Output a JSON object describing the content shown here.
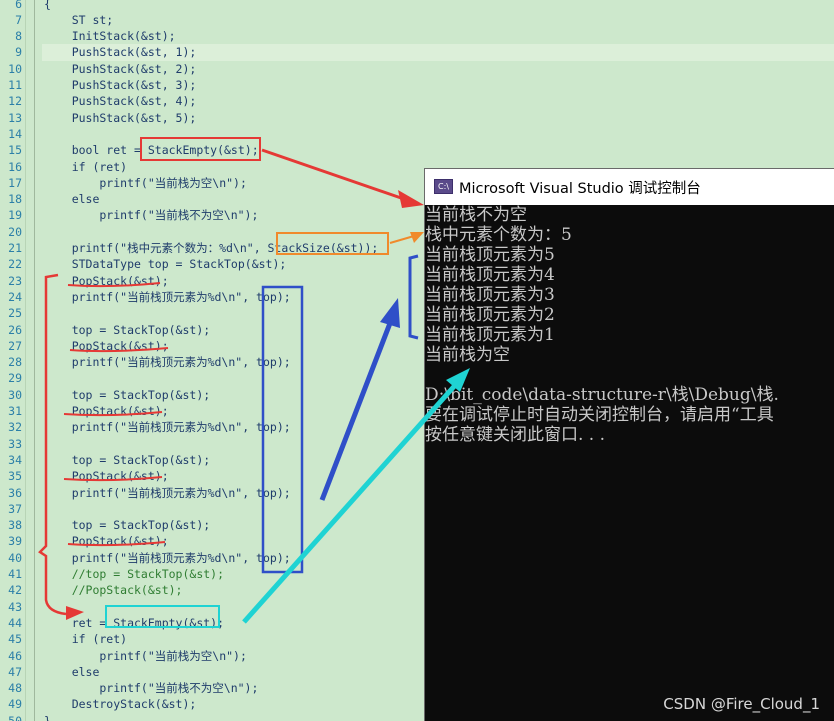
{
  "editor": {
    "lines": [
      {
        "n": "6",
        "text": "{"
      },
      {
        "n": "7",
        "text": "    ST st;"
      },
      {
        "n": "8",
        "text": "    InitStack(&st);"
      },
      {
        "n": "9",
        "text": "    PushStack(&st, 1);"
      },
      {
        "n": "10",
        "text": "    PushStack(&st, 2);"
      },
      {
        "n": "11",
        "text": "    PushStack(&st, 3);"
      },
      {
        "n": "12",
        "text": "    PushStack(&st, 4);"
      },
      {
        "n": "13",
        "text": "    PushStack(&st, 5);"
      },
      {
        "n": "14",
        "text": ""
      },
      {
        "n": "15",
        "text": "    bool ret = StackEmpty(&st);"
      },
      {
        "n": "16",
        "text": "    if (ret)"
      },
      {
        "n": "17",
        "text": "        printf(\"当前栈为空\\n\");"
      },
      {
        "n": "18",
        "text": "    else"
      },
      {
        "n": "19",
        "text": "        printf(\"当前栈不为空\\n\");"
      },
      {
        "n": "20",
        "text": ""
      },
      {
        "n": "21",
        "text": "    printf(\"栈中元素个数为：%d\\n\", StackSize(&st));"
      },
      {
        "n": "22",
        "text": "    STDataType top = StackTop(&st);"
      },
      {
        "n": "23",
        "text": "    PopStack(&st);"
      },
      {
        "n": "24",
        "text": "    printf(\"当前栈顶元素为%d\\n\", top);"
      },
      {
        "n": "25",
        "text": ""
      },
      {
        "n": "26",
        "text": "    top = StackTop(&st);"
      },
      {
        "n": "27",
        "text": "    PopStack(&st);"
      },
      {
        "n": "28",
        "text": "    printf(\"当前栈顶元素为%d\\n\", top);"
      },
      {
        "n": "29",
        "text": ""
      },
      {
        "n": "30",
        "text": "    top = StackTop(&st);"
      },
      {
        "n": "31",
        "text": "    PopStack(&st);"
      },
      {
        "n": "32",
        "text": "    printf(\"当前栈顶元素为%d\\n\", top);"
      },
      {
        "n": "33",
        "text": ""
      },
      {
        "n": "34",
        "text": "    top = StackTop(&st);"
      },
      {
        "n": "35",
        "text": "    PopStack(&st);"
      },
      {
        "n": "36",
        "text": "    printf(\"当前栈顶元素为%d\\n\", top);"
      },
      {
        "n": "37",
        "text": ""
      },
      {
        "n": "38",
        "text": "    top = StackTop(&st);"
      },
      {
        "n": "39",
        "text": "    PopStack(&st);"
      },
      {
        "n": "40",
        "text": "    printf(\"当前栈顶元素为%d\\n\", top);"
      },
      {
        "n": "41",
        "text": "    //top = StackTop(&st);"
      },
      {
        "n": "42",
        "text": "    //PopStack(&st);"
      },
      {
        "n": "43",
        "text": ""
      },
      {
        "n": "44",
        "text": "    ret = StackEmpty(&st);"
      },
      {
        "n": "45",
        "text": "    if (ret)"
      },
      {
        "n": "46",
        "text": "        printf(\"当前栈为空\\n\");"
      },
      {
        "n": "47",
        "text": "    else"
      },
      {
        "n": "48",
        "text": "        printf(\"当前栈不为空\\n\");"
      },
      {
        "n": "49",
        "text": "    DestroyStack(&st);"
      },
      {
        "n": "50",
        "text": "}"
      }
    ]
  },
  "console": {
    "title": "Microsoft Visual Studio 调试控制台",
    "icon_label": "C:\\",
    "lines": [
      "当前栈不为空",
      "栈中元素个数为：5",
      "当前栈顶元素为5",
      "当前栈顶元素为4",
      "当前栈顶元素为3",
      "当前栈顶元素为2",
      "当前栈顶元素为1",
      "当前栈为空",
      "",
      "D:\\bit_code\\data-structure-r\\栈\\Debug\\栈.",
      "要在调试停止时自动关闭控制台，请启用“工具",
      "按任意键关闭此窗口. . ."
    ]
  },
  "watermark": "CSDN @Fire_Cloud_1",
  "colors": {
    "editor_bg": "#cde8cc",
    "console_bg": "#0c0c0c",
    "annotation_red": "#e53935",
    "annotation_orange": "#f08a2c",
    "annotation_blue": "#2f4fc8",
    "annotation_cyan": "#1fd3d3"
  }
}
